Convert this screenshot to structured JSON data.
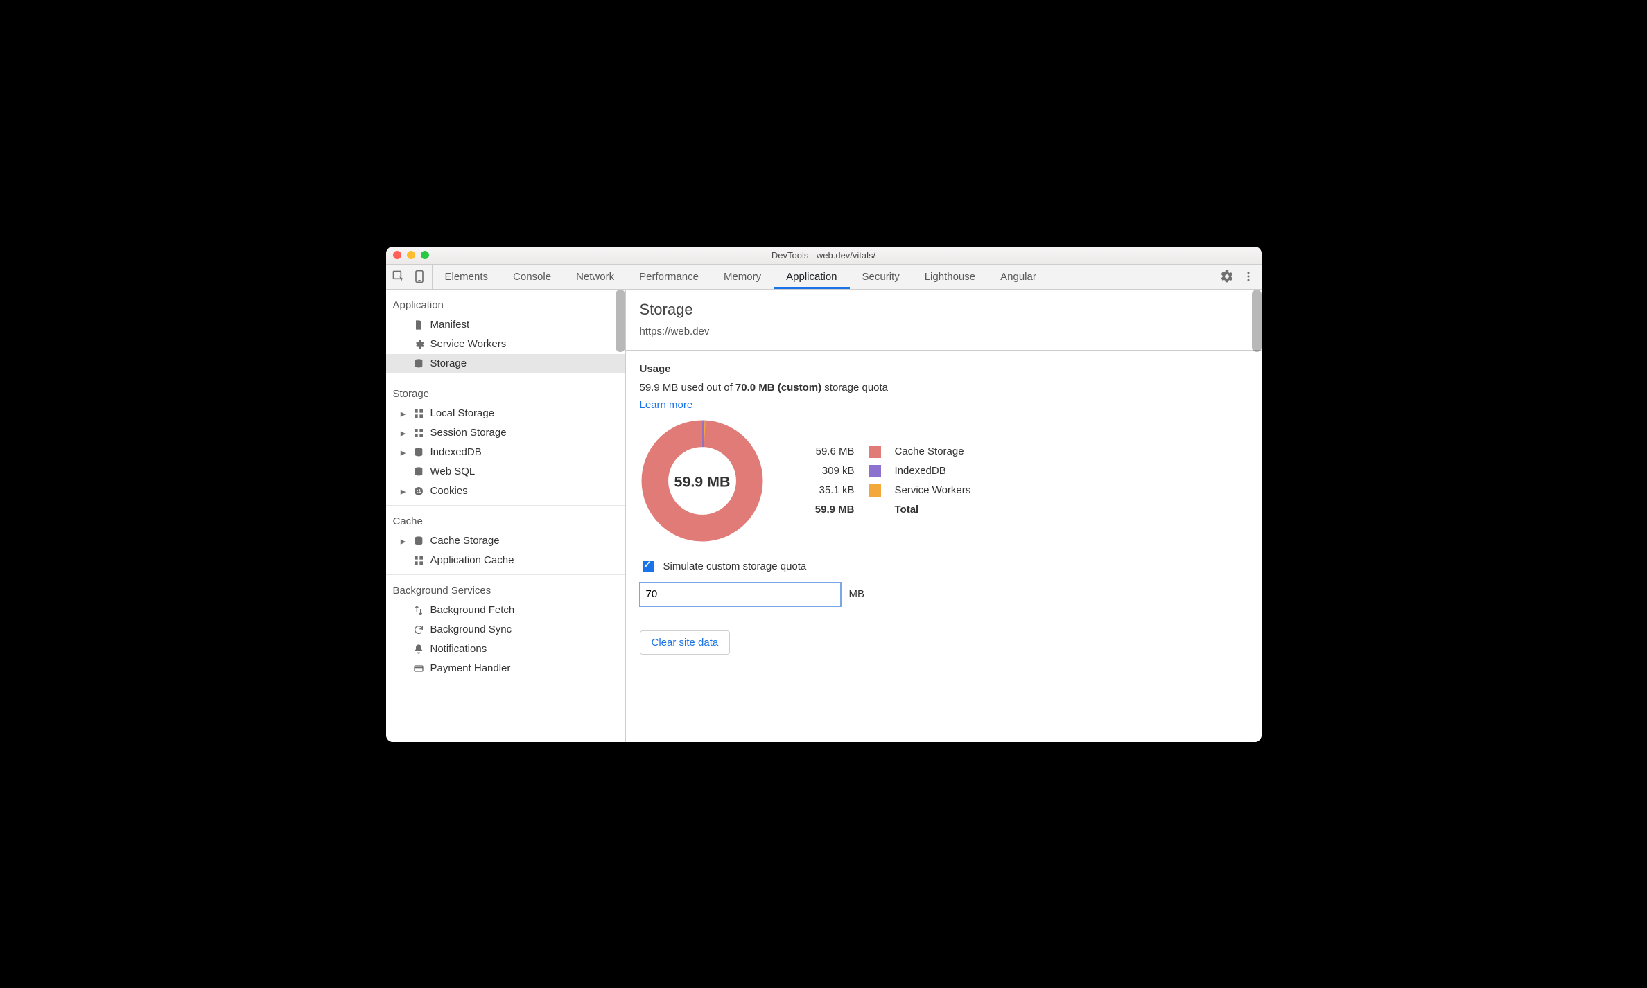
{
  "window": {
    "title": "DevTools - web.dev/vitals/"
  },
  "tabs": {
    "items": [
      "Elements",
      "Console",
      "Network",
      "Performance",
      "Memory",
      "Application",
      "Security",
      "Lighthouse",
      "Angular"
    ],
    "active_index": 5
  },
  "sidebar": {
    "sections": [
      {
        "title": "Application",
        "items": [
          {
            "label": "Manifest",
            "icon": "file",
            "expandable": false
          },
          {
            "label": "Service Workers",
            "icon": "gear",
            "expandable": false
          },
          {
            "label": "Storage",
            "icon": "db",
            "expandable": false,
            "selected": true
          }
        ]
      },
      {
        "title": "Storage",
        "items": [
          {
            "label": "Local Storage",
            "icon": "grid",
            "expandable": true
          },
          {
            "label": "Session Storage",
            "icon": "grid",
            "expandable": true
          },
          {
            "label": "IndexedDB",
            "icon": "db",
            "expandable": true
          },
          {
            "label": "Web SQL",
            "icon": "db",
            "expandable": false
          },
          {
            "label": "Cookies",
            "icon": "cookie",
            "expandable": true
          }
        ]
      },
      {
        "title": "Cache",
        "items": [
          {
            "label": "Cache Storage",
            "icon": "db",
            "expandable": true
          },
          {
            "label": "Application Cache",
            "icon": "grid",
            "expandable": false
          }
        ]
      },
      {
        "title": "Background Services",
        "items": [
          {
            "label": "Background Fetch",
            "icon": "updown",
            "expandable": false
          },
          {
            "label": "Background Sync",
            "icon": "sync",
            "expandable": false
          },
          {
            "label": "Notifications",
            "icon": "bell",
            "expandable": false
          },
          {
            "label": "Payment Handler",
            "icon": "card",
            "expandable": false
          }
        ]
      }
    ]
  },
  "storage_panel": {
    "heading": "Storage",
    "origin": "https://web.dev",
    "usage_section_title": "Usage",
    "usage_prefix": "59.9 MB used out of ",
    "usage_bold": "70.0 MB (custom)",
    "usage_suffix": " storage quota",
    "learn_more": "Learn more",
    "pie_total": "59.9 MB",
    "breakdown": [
      {
        "size": "59.6 MB",
        "label": "Cache Storage",
        "color": "#e17b78"
      },
      {
        "size": "309 kB",
        "label": "IndexedDB",
        "color": "#8c72ce"
      },
      {
        "size": "35.1 kB",
        "label": "Service Workers",
        "color": "#f3a83c"
      }
    ],
    "total_size": "59.9 MB",
    "total_label": "Total",
    "simulate_label": "Simulate custom storage quota",
    "simulate_checked": true,
    "quota_value": "70",
    "quota_unit": "MB",
    "clear_button": "Clear site data"
  },
  "chart_data": {
    "type": "pie",
    "title": "Storage usage breakdown",
    "total_label": "59.9 MB",
    "total_bytes": 59900000,
    "series": [
      {
        "name": "Cache Storage",
        "value_bytes": 59600000,
        "display": "59.6 MB",
        "color": "#e17b78",
        "fraction": 0.995
      },
      {
        "name": "IndexedDB",
        "value_bytes": 309000,
        "display": "309 kB",
        "color": "#8c72ce",
        "fraction": 0.00516
      },
      {
        "name": "Service Workers",
        "value_bytes": 35100,
        "display": "35.1 kB",
        "color": "#f3a83c",
        "fraction": 0.000586
      }
    ]
  }
}
